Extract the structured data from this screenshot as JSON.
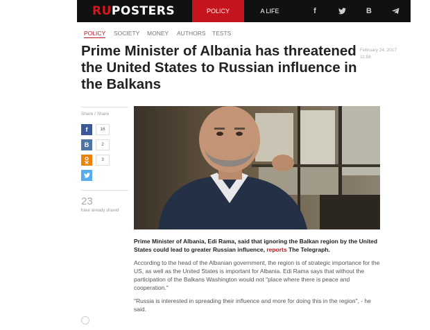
{
  "header": {
    "logo_ru": "RU",
    "logo_rest": "POSTERS",
    "nav": [
      {
        "label": "POLICY"
      },
      {
        "label": "A LIFE"
      }
    ],
    "social": [
      {
        "icon": "facebook-icon",
        "glyph": "f"
      },
      {
        "icon": "twitter-icon",
        "glyph": "🐦"
      },
      {
        "icon": "vk-icon",
        "glyph": "B"
      },
      {
        "icon": "telegram-icon",
        "glyph": "➤"
      }
    ]
  },
  "subnav": [
    {
      "label": "POLICY",
      "active": true
    },
    {
      "label": "SOCIETY"
    },
    {
      "label": "MONEY"
    },
    {
      "label": "AUTHORS"
    },
    {
      "label": "TESTS"
    }
  ],
  "article": {
    "title": "Prime Minister of Albania has threatened the United States to Russian influence in the Balkans",
    "date": "February 24, 2017",
    "time": "11:58",
    "lead_text": "Prime Minister of Albania, Edi Rama, said that ignoring the Balkan region by the United States could lead to greater Russian influence,",
    "lead_link": "reports",
    "lead_source": "The Telegraph.",
    "paragraphs": [
      "According to the head of the Albanian government, the region is of strategic importance for the US, as well as the United States is important for Albania. Edi Rama says that without the participation of the Balkans Washington would not \"place where there is peace and cooperation.\"",
      "\"Russia is interested in spreading their influence and more for doing this in the region\", - he said."
    ]
  },
  "share": {
    "label": "Share / Share",
    "buttons": [
      {
        "network": "facebook",
        "glyph": "f",
        "color": "#3b5998",
        "count": "16"
      },
      {
        "network": "vkontakte",
        "glyph": "B",
        "color": "#4c75a3",
        "count": "2"
      },
      {
        "network": "odnoklassniki",
        "glyph": "ok",
        "color": "#ee8208",
        "count": "3"
      },
      {
        "network": "twitter",
        "glyph": "t",
        "color": "#55acee"
      }
    ],
    "total": "23",
    "total_label": "have already shared"
  },
  "colors": {
    "brand_red": "#c4151c",
    "topbar": "#111111"
  }
}
